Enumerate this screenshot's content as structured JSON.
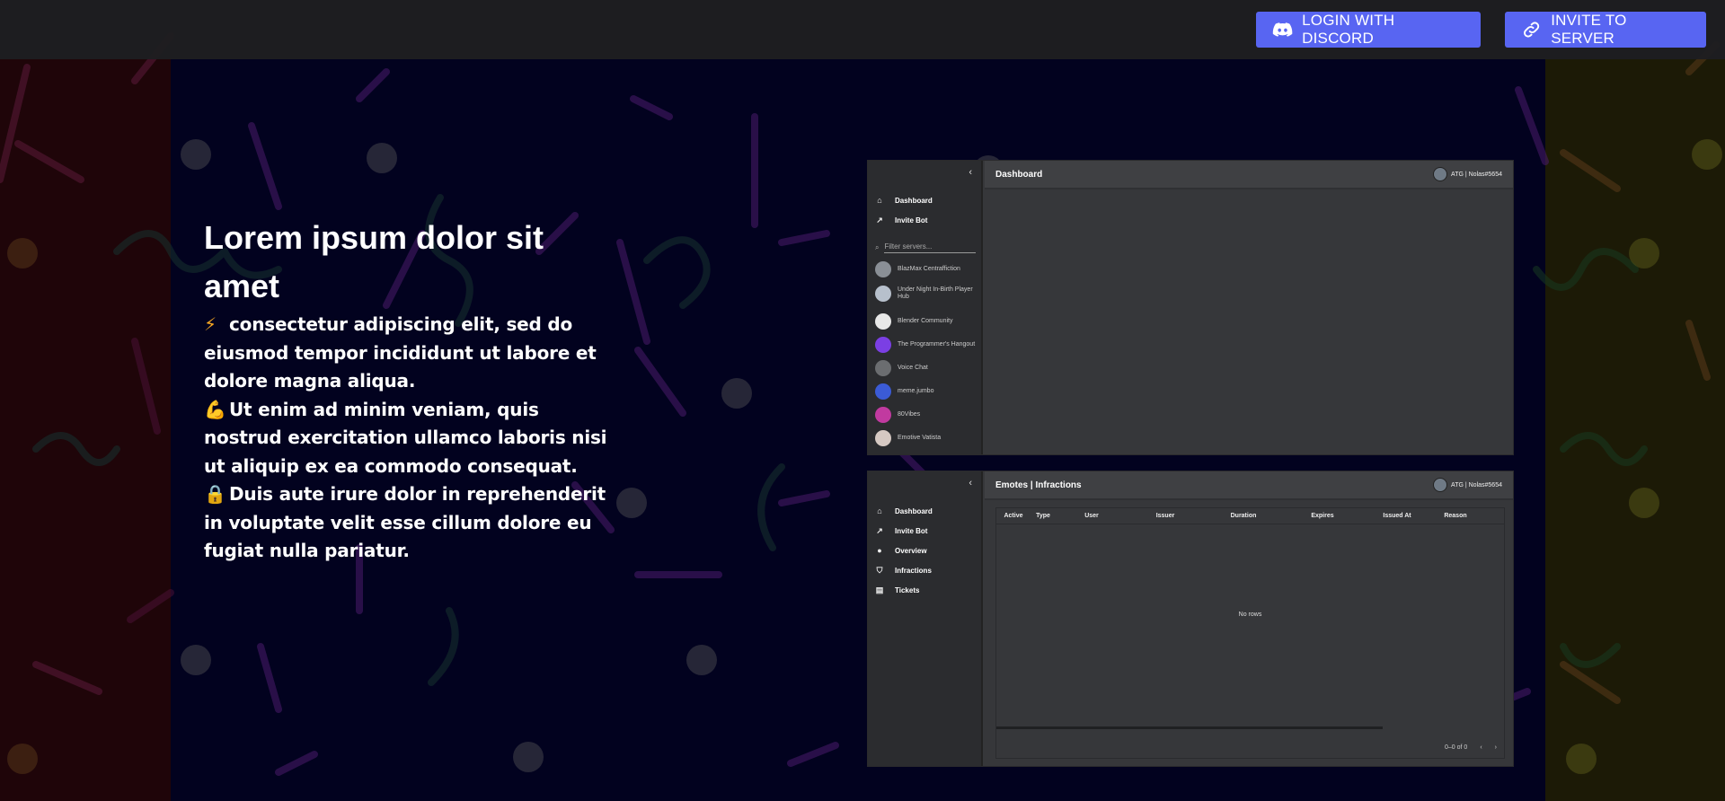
{
  "topbar": {
    "login_label": "LOGIN WITH DISCORD",
    "invite_label": "INVITE TO SERVER",
    "button_color": "#5865f2"
  },
  "hero": {
    "title": "Lorem ipsum dolor sit amet",
    "lines": [
      {
        "icon": "lightning-icon",
        "emoji": "⚡",
        "text": "consectetur adipiscing elit, sed do eiusmod tempor incididunt ut labore et dolore magna aliqua."
      },
      {
        "icon": "flexed-biceps-icon",
        "emoji": "💪",
        "text": "Ut enim ad minim veniam, quis nostrud exercitation ullamco laboris nisi ut aliquip ex ea commodo consequat."
      },
      {
        "icon": "lock-icon",
        "emoji": "🔒",
        "text": "Duis aute irure dolor in reprehenderit in voluptate velit esse cillum dolore eu fugiat nulla pariatur."
      }
    ]
  },
  "shot1": {
    "title": "Dashboard",
    "user": "ATG | Nolas#5654",
    "nav": [
      {
        "label": "Dashboard",
        "icon": "home-icon"
      },
      {
        "label": "Invite Bot",
        "icon": "external-link-icon"
      }
    ],
    "filter_placeholder": "Filter servers...",
    "servers": [
      {
        "name": "BlazMax Centraffiction",
        "color": "#8a8f96"
      },
      {
        "name": "Under Night In-Birth Player Hub",
        "color": "#b7c0cc"
      },
      {
        "name": "Blender Community",
        "color": "#e8e8e8"
      },
      {
        "name": "The Programmer's Hangout",
        "color": "#7b3fe4"
      },
      {
        "name": "Voice Chat",
        "color": "#6b6d70"
      },
      {
        "name": "meme.jumbo",
        "color": "#3b5bd6"
      },
      {
        "name": "80Vibes",
        "color": "#c13aa0"
      },
      {
        "name": "Emotive Vatista",
        "color": "#d6c9c3"
      }
    ]
  },
  "shot2": {
    "title": "Emotes | Infractions",
    "user": "ATG | Nolas#5654",
    "nav": [
      {
        "label": "Dashboard",
        "icon": "home-icon"
      },
      {
        "label": "Invite Bot",
        "icon": "external-link-icon"
      },
      {
        "label": "Overview",
        "icon": "circle-icon"
      },
      {
        "label": "Infractions",
        "icon": "shield-icon"
      },
      {
        "label": "Tickets",
        "icon": "chat-icon"
      }
    ],
    "columns": [
      "Active",
      "Type",
      "User",
      "Issuer",
      "Duration",
      "Expires",
      "Issued At",
      "Reason"
    ],
    "empty_text": "No rows",
    "pagination": "0–0 of 0",
    "prev": "‹",
    "next": "›"
  }
}
